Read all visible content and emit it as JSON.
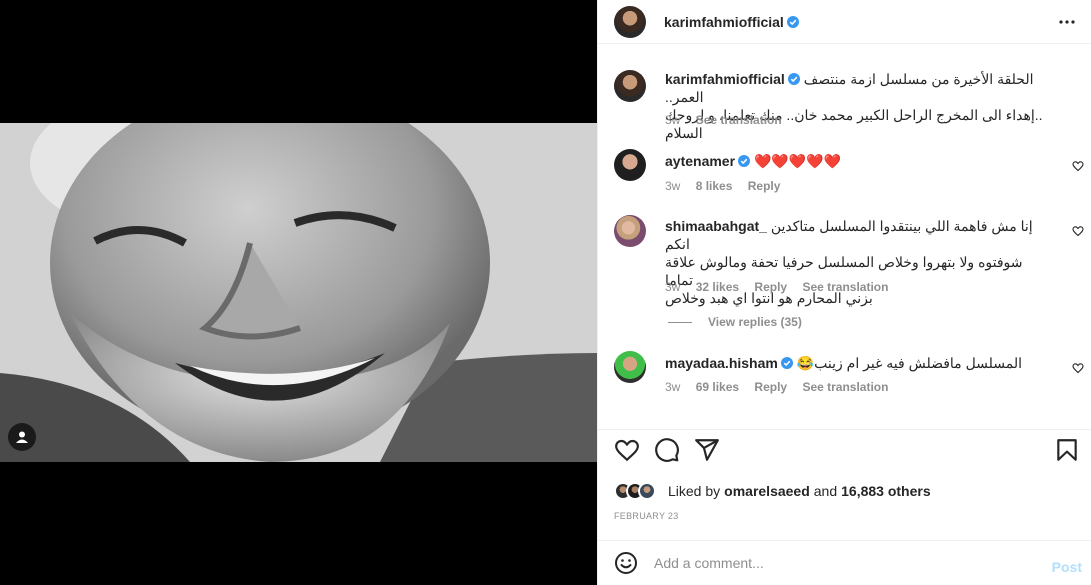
{
  "post": {
    "author": "karimfahmiofficial",
    "caption_line1": "الحلقة الأخيرة من مسلسل ازمة منتصف العمر..",
    "caption_line2": "..إهداء الى المخرج الراحل الكبير محمد خان.. منك تعلمنا، و لروحك السلام",
    "caption_time": "3w",
    "see_translation": "See translation",
    "date": "FEBRUARY 23",
    "liked_by_prefix": "Liked by",
    "liked_by_user": "omarelsaeed",
    "liked_by_and": "and",
    "liked_by_others": "16,883 others"
  },
  "comments": [
    {
      "user": "aytenamer",
      "verified": true,
      "text": "❤️❤️❤️❤️❤️",
      "time": "3w",
      "likes": "8 likes",
      "reply": "Reply",
      "translate": ""
    },
    {
      "user": "shimaabahgat_",
      "verified": false,
      "line1": "إنا مش فاهمة اللي بينتقدوا المسلسل متاكدين انكم",
      "line2": "شوفتوه ولا بتهروا وخلاص المسلسل حرفيا تحفة ومالوش علاقة تماما",
      "line3": "بزني المحارم هو انتوا اي هبد وخلاص",
      "time": "3w",
      "likes": "32 likes",
      "reply": "Reply",
      "translate": "See translation",
      "view_replies": "View replies (35)"
    },
    {
      "user": "mayadaa.hisham",
      "verified": true,
      "text": "المسلسل مافضلش فيه غير ام زينب😂",
      "time": "3w",
      "likes": "69 likes",
      "reply": "Reply",
      "translate": "See translation"
    }
  ],
  "add_comment": {
    "placeholder": "Add a comment...",
    "post_label": "Post"
  },
  "icons": {
    "more": "more-icon",
    "verified": "verified-badge-icon",
    "heart": "heart-icon",
    "comment": "comment-icon",
    "share": "share-icon",
    "save": "bookmark-icon",
    "emoji": "emoji-icon",
    "user_tag": "user-tag-icon"
  },
  "colors": {
    "verified_blue": "#3897f0",
    "heart_red": "#ed4956",
    "post_disabled": "#b2dffc",
    "meta_gray": "#8e8e8e"
  }
}
